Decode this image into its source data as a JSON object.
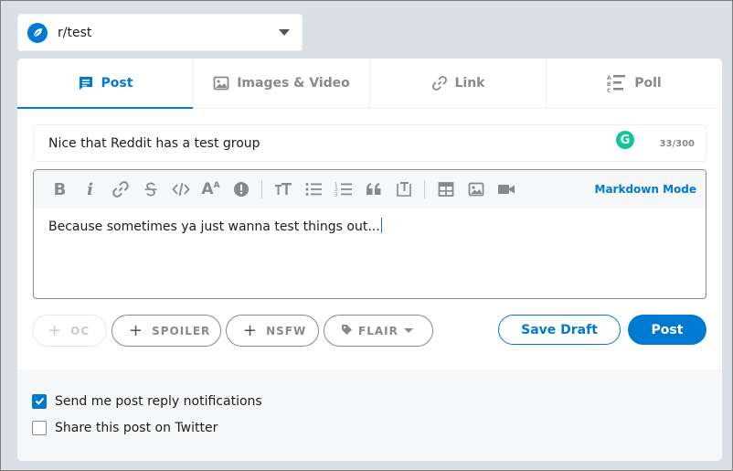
{
  "community": {
    "name": "r/test"
  },
  "tabs": [
    {
      "label": "Post",
      "icon": "post-icon",
      "active": true
    },
    {
      "label": "Images & Video",
      "icon": "image-icon"
    },
    {
      "label": "Link",
      "icon": "link-icon"
    },
    {
      "label": "Poll",
      "icon": "poll-icon"
    }
  ],
  "title": {
    "value": "Nice that Reddit has a test group",
    "count": "33/300",
    "grammarly": "G"
  },
  "editor": {
    "toolbar_icons": [
      "bold-icon",
      "italic-icon",
      "link-icon",
      "strikethrough-icon",
      "code-icon",
      "superscript-icon",
      "spoiler-icon",
      "heading-icon",
      "bulleted-list-icon",
      "numbered-list-icon",
      "quote-icon",
      "code-block-icon",
      "table-icon",
      "image-icon",
      "video-icon"
    ],
    "toolbar_glyphs": {
      "bold": "B",
      "italic": "i",
      "superscript": "A"
    },
    "mode_label": "Markdown Mode",
    "body": "Because sometimes ya just wanna test things out..."
  },
  "tags": {
    "oc": "OC",
    "spoiler": "SPOILER",
    "nsfw": "NSFW",
    "flair": "FLAIR"
  },
  "actions": {
    "save_draft": "Save Draft",
    "post": "Post"
  },
  "options": {
    "notifications": {
      "label": "Send me post reply notifications",
      "checked": true
    },
    "twitter": {
      "label": "Share this post on Twitter",
      "checked": false
    }
  },
  "colors": {
    "accent": "#0079d3",
    "page_bg": "#dae0e6"
  }
}
